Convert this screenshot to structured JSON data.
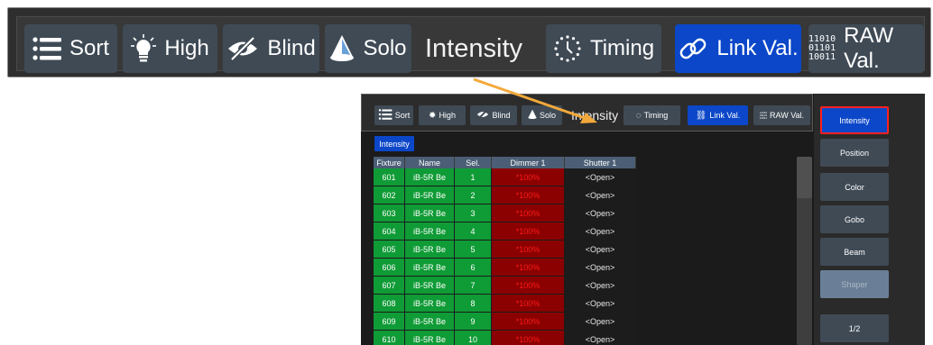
{
  "colors": {
    "button_bg": "#3f4a55",
    "active_bg": "#0b47c8",
    "fixture_green": "#0f9b36",
    "dimmer_red": "#8b0000",
    "arrow": "#f2a93b"
  },
  "toolbar": {
    "sort": {
      "label": "Sort",
      "icon": "list-icon"
    },
    "high": {
      "label": "High",
      "icon": "lightbulb-icon"
    },
    "blind": {
      "label": "Blind",
      "icon": "eye-slash-icon"
    },
    "solo": {
      "label": "Solo",
      "icon": "spotlight-icon"
    },
    "title": "Intensity",
    "timing": {
      "label": "Timing",
      "icon": "timing-icon"
    },
    "link": {
      "label": "Link Val.",
      "icon": "link-icon",
      "active": true
    },
    "raw": {
      "label": "RAW Val.",
      "icon": "binary-icon",
      "icon_text": [
        "11010",
        "01101",
        "10011"
      ]
    }
  },
  "mini": {
    "tab": "Intensity",
    "columns": [
      "Fixture",
      "Name",
      "Sel.",
      "Dimmer 1",
      "Shutter 1"
    ],
    "rows": [
      [
        "601",
        "iB-5R Be",
        "1",
        "*100%",
        "<Open>"
      ],
      [
        "602",
        "iB-5R Be",
        "2",
        "*100%",
        "<Open>"
      ],
      [
        "603",
        "iB-5R Be",
        "3",
        "*100%",
        "<Open>"
      ],
      [
        "604",
        "iB-5R Be",
        "4",
        "*100%",
        "<Open>"
      ],
      [
        "605",
        "iB-5R Be",
        "5",
        "*100%",
        "<Open>"
      ],
      [
        "606",
        "iB-5R Be",
        "6",
        "*100%",
        "<Open>"
      ],
      [
        "607",
        "iB-5R Be",
        "7",
        "*100%",
        "<Open>"
      ],
      [
        "608",
        "iB-5R Be",
        "8",
        "*100%",
        "<Open>"
      ],
      [
        "609",
        "iB-5R Be",
        "9",
        "*100%",
        "<Open>"
      ],
      [
        "610",
        "iB-5R Be",
        "10",
        "*100%",
        "<Open>"
      ]
    ],
    "side": [
      "Intensity",
      "Position",
      "Color",
      "Gobo",
      "Beam",
      "Shaper",
      "1/2"
    ]
  }
}
